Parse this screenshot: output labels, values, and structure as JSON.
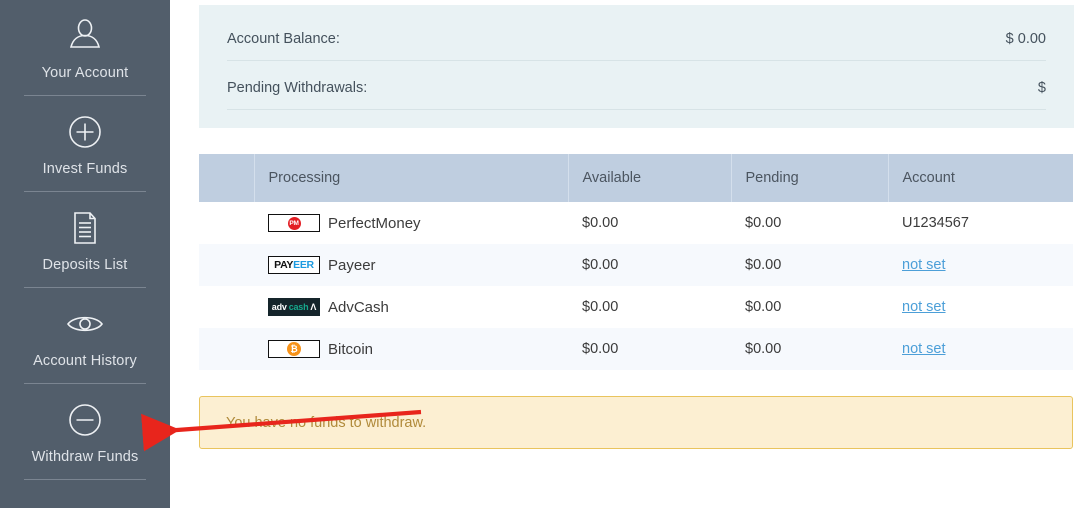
{
  "sidebar": {
    "items": [
      {
        "label": "Your Account",
        "icon": "user-icon"
      },
      {
        "label": "Invest Funds",
        "icon": "plus-circle-icon"
      },
      {
        "label": "Deposits List",
        "icon": "document-icon"
      },
      {
        "label": "Account History",
        "icon": "eye-icon"
      },
      {
        "label": "Withdraw Funds",
        "icon": "minus-circle-icon"
      }
    ]
  },
  "balance": {
    "account_balance_label": "Account Balance:",
    "account_balance_value": "$ 0.00",
    "pending_withdrawals_label": "Pending Withdrawals:",
    "pending_withdrawals_value": "$"
  },
  "table": {
    "headers": [
      "",
      "Processing",
      "Available",
      "Pending",
      "Account"
    ],
    "rows": [
      {
        "logo": "perfectmoney-logo",
        "name": "PerfectMoney",
        "available": "$0.00",
        "pending": "$0.00",
        "account": "U1234567",
        "account_is_link": false
      },
      {
        "logo": "payeer-logo",
        "name": "Payeer",
        "available": "$0.00",
        "pending": "$0.00",
        "account": "not set",
        "account_is_link": true
      },
      {
        "logo": "advcash-logo",
        "name": "AdvCash",
        "available": "$0.00",
        "pending": "$0.00",
        "account": "not set",
        "account_is_link": true
      },
      {
        "logo": "bitcoin-logo",
        "name": "Bitcoin",
        "available": "$0.00",
        "pending": "$0.00",
        "account": "not set",
        "account_is_link": true
      }
    ]
  },
  "alert": {
    "message": "You have no funds to withdraw."
  },
  "annotation": {
    "arrow_color": "#e8251c"
  },
  "logos": {
    "perfectmoney_text": "PM",
    "payeer_text_1": "PAY",
    "payeer_text_2": "EER",
    "advcash_text_1": "adv",
    "advcash_text_2": "cash",
    "advcash_text_3": "Ʌ",
    "bitcoin_text": "₿"
  },
  "colors": {
    "sidebar_bg": "#525e6b",
    "balance_panel_bg": "#e9f2f4",
    "table_header_bg": "#bfcee0",
    "alert_bg": "#fcefd2",
    "alert_border": "#e9c45e",
    "amount_green": "#2f8f3e",
    "amount_red": "#f0463c",
    "link_blue": "#4c9fd8"
  }
}
